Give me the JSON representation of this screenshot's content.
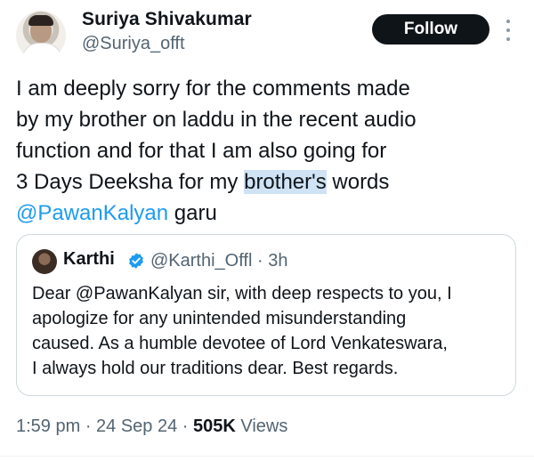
{
  "author": {
    "display_name": "Suriya Shivakumar",
    "handle": "@Suriya_offt"
  },
  "follow_button": {
    "label": "Follow"
  },
  "tweet": {
    "lines": [
      "I am deeply sorry for the comments made",
      "by my brother on laddu in the recent audio",
      "function and for that I am also going for"
    ],
    "line4_before": "3 Days Deeksha for my ",
    "line4_highlight": "brother's",
    "line4_after": " words",
    "mention": "@PawanKalyan",
    "mention_suffix": " garu"
  },
  "quote": {
    "display_name": "Karthi",
    "handle_time": "@Karthi_Offl · 3h",
    "lines": [
      "Dear @PawanKalyan sir, with deep respects to you, I",
      "apologize for any unintended misunderstanding",
      "caused. As a humble devotee of Lord Venkateswara,",
      "I always hold our traditions dear. Best regards."
    ]
  },
  "meta": {
    "time_date": "1:59 pm · 24 Sep 24 · ",
    "views_count": "505K",
    "views_label": " Views"
  },
  "colors": {
    "mention": "#1d9bf0",
    "highlight": "#cfe3f5",
    "secondary_text": "#536471",
    "follow_button_bg": "#0f1419"
  },
  "icons": {
    "more": "more-vertical-icon",
    "verified": "verified-badge-icon"
  }
}
